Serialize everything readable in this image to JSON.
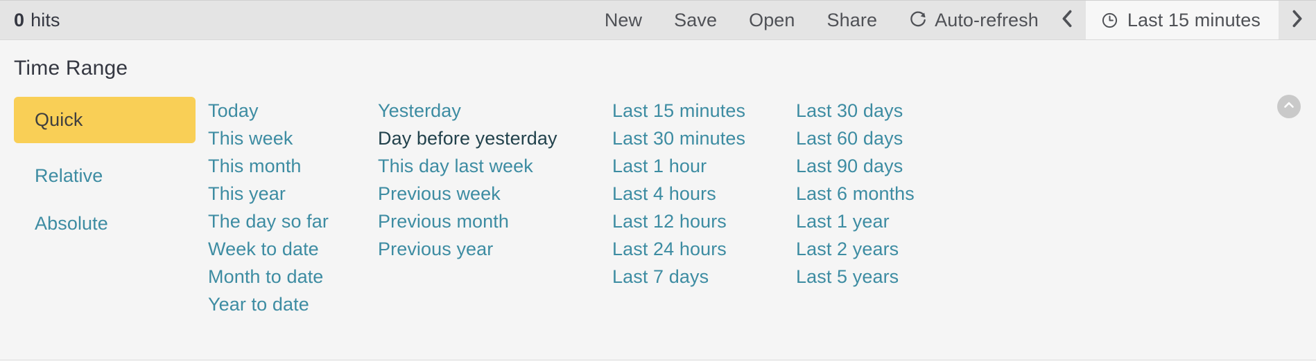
{
  "toolbar": {
    "hits_count": "0",
    "hits_label": "hits",
    "actions": [
      {
        "name": "new",
        "label": "New"
      },
      {
        "name": "save",
        "label": "Save"
      },
      {
        "name": "open",
        "label": "Open"
      },
      {
        "name": "share",
        "label": "Share"
      }
    ],
    "auto_refresh_label": "Auto-refresh",
    "auto_refresh_icon": "refresh-icon",
    "prev_icon": "chevron-left-icon",
    "next_icon": "chevron-right-icon",
    "time_display": {
      "icon": "clock-icon",
      "label": "Last 15 minutes"
    }
  },
  "panel": {
    "title": "Time Range",
    "collapse_icon": "chevron-up-icon",
    "tabs": [
      {
        "name": "quick",
        "label": "Quick",
        "selected": true
      },
      {
        "name": "relative",
        "label": "Relative",
        "selected": false
      },
      {
        "name": "absolute",
        "label": "Absolute",
        "selected": false
      }
    ],
    "columns": [
      {
        "name": "column-calendar-current",
        "items": [
          {
            "label": "Today",
            "hovered": false
          },
          {
            "label": "This week",
            "hovered": false
          },
          {
            "label": "This month",
            "hovered": false
          },
          {
            "label": "This year",
            "hovered": false
          },
          {
            "label": "The day so far",
            "hovered": false
          },
          {
            "label": "Week to date",
            "hovered": false
          },
          {
            "label": "Month to date",
            "hovered": false
          },
          {
            "label": "Year to date",
            "hovered": false
          }
        ]
      },
      {
        "name": "column-calendar-previous",
        "items": [
          {
            "label": "Yesterday",
            "hovered": false
          },
          {
            "label": "Day before yesterday",
            "hovered": true
          },
          {
            "label": "This day last week",
            "hovered": false
          },
          {
            "label": "Previous week",
            "hovered": false
          },
          {
            "label": "Previous month",
            "hovered": false
          },
          {
            "label": "Previous year",
            "hovered": false
          }
        ]
      },
      {
        "name": "column-relative-short",
        "items": [
          {
            "label": "Last 15 minutes",
            "hovered": false
          },
          {
            "label": "Last 30 minutes",
            "hovered": false
          },
          {
            "label": "Last 1 hour",
            "hovered": false
          },
          {
            "label": "Last 4 hours",
            "hovered": false
          },
          {
            "label": "Last 12 hours",
            "hovered": false
          },
          {
            "label": "Last 24 hours",
            "hovered": false
          },
          {
            "label": "Last 7 days",
            "hovered": false
          }
        ]
      },
      {
        "name": "column-relative-long",
        "items": [
          {
            "label": "Last 30 days",
            "hovered": false
          },
          {
            "label": "Last 60 days",
            "hovered": false
          },
          {
            "label": "Last 90 days",
            "hovered": false
          },
          {
            "label": "Last 6 months",
            "hovered": false
          },
          {
            "label": "Last 1 year",
            "hovered": false
          },
          {
            "label": "Last 2 years",
            "hovered": false
          },
          {
            "label": "Last 5 years",
            "hovered": false
          }
        ]
      }
    ]
  },
  "colors": {
    "accent_link": "#3d8ca2",
    "selected_tab_bg": "#f9cf56",
    "toolbar_bg": "#e4e4e4",
    "panel_bg": "#f5f5f5",
    "text_dark": "#343741",
    "hovered_link": "#22424c"
  }
}
